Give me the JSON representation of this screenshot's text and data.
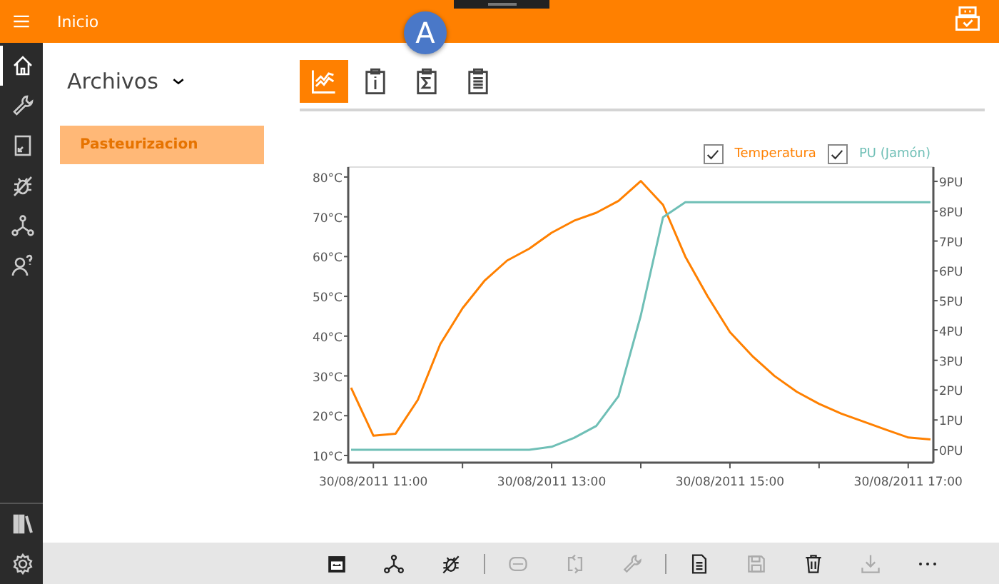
{
  "header": {
    "title": "Inicio",
    "badge": "A"
  },
  "rail": [
    {
      "selected": true
    },
    {
      "selected": false
    },
    {
      "selected": false
    },
    {
      "selected": false
    },
    {
      "selected": false
    },
    {
      "selected": false
    },
    {
      "selected": false
    },
    {
      "selected": false
    }
  ],
  "files": {
    "title": "Archivos",
    "items": [
      {
        "label": "Pasteurizacion",
        "selected": true
      }
    ]
  },
  "view_tabs": [
    {
      "selected": true
    },
    {
      "selected": false
    },
    {
      "selected": false
    },
    {
      "selected": false
    }
  ],
  "legend": [
    {
      "checked": true
    },
    {
      "checked": true
    }
  ],
  "chart": {
    "chart_data": {
      "type": "line",
      "categories": [
        null,
        "30/08/2011 11:00",
        null,
        null,
        null,
        null,
        null,
        null,
        null,
        "30/08/2011 13:00",
        null,
        null,
        null,
        null,
        null,
        null,
        null,
        "30/08/2011 15:00",
        null,
        null,
        null,
        null,
        null,
        null,
        null,
        "30/08/2011 17:00",
        null
      ],
      "ylim": [
        8.2,
        82.5
      ],
      "yticks": [
        {
          "value": 80,
          "label": "80°C"
        },
        {
          "value": 70,
          "label": "70°C"
        },
        {
          "value": 60,
          "label": "60°C"
        },
        {
          "value": 50,
          "label": "50°C"
        },
        {
          "value": 40,
          "label": "40°C"
        },
        {
          "value": 30,
          "label": "30°C"
        },
        {
          "value": 20,
          "label": "20°C"
        },
        {
          "value": 10,
          "label": "10°C"
        }
      ],
      "y2lim": [
        -0.43,
        9.48
      ],
      "y2ticks": [
        {
          "value": 9,
          "label": "9PU"
        },
        {
          "value": 8,
          "label": "8PU"
        },
        {
          "value": 7,
          "label": "7PU"
        },
        {
          "value": 6,
          "label": "6PU"
        },
        {
          "value": 5,
          "label": "5PU"
        },
        {
          "value": 4,
          "label": "4PU"
        },
        {
          "value": 3,
          "label": "3PU"
        },
        {
          "value": 2,
          "label": "2PU"
        },
        {
          "value": 1,
          "label": "1PU"
        },
        {
          "value": 0,
          "label": "0PU"
        }
      ],
      "series": [
        {
          "name": "Temperatura",
          "color": "#ff8000",
          "values": [
            27,
            15,
            15.5,
            24,
            38,
            47,
            54,
            59,
            62,
            66,
            69,
            71,
            74,
            79,
            73,
            60,
            50,
            41,
            35,
            30,
            26,
            23,
            20.5,
            18.5,
            16.5,
            14.5,
            14
          ]
        },
        {
          "name": "PU (Jamón)",
          "color": "#6fbfb6",
          "axis": "y2",
          "values": [
            0,
            0,
            0,
            0,
            0,
            0,
            0,
            0,
            0,
            0.1,
            0.4,
            0.8,
            1.8,
            4.5,
            7.8,
            8.3,
            8.3,
            8.3,
            8.3,
            8.3,
            8.3,
            8.3,
            8.3,
            8.3,
            8.3,
            8.3,
            8.3
          ]
        }
      ]
    }
  },
  "toolbar": [
    {
      "disabled": false
    },
    {
      "disabled": false
    },
    {
      "disabled": false
    },
    {
      "disabled": true
    },
    {
      "disabled": true
    },
    {
      "disabled": true
    },
    {
      "disabled": false
    },
    {
      "disabled": true
    },
    {
      "disabled": false
    },
    {
      "disabled": true
    },
    {
      "disabled": false
    }
  ]
}
